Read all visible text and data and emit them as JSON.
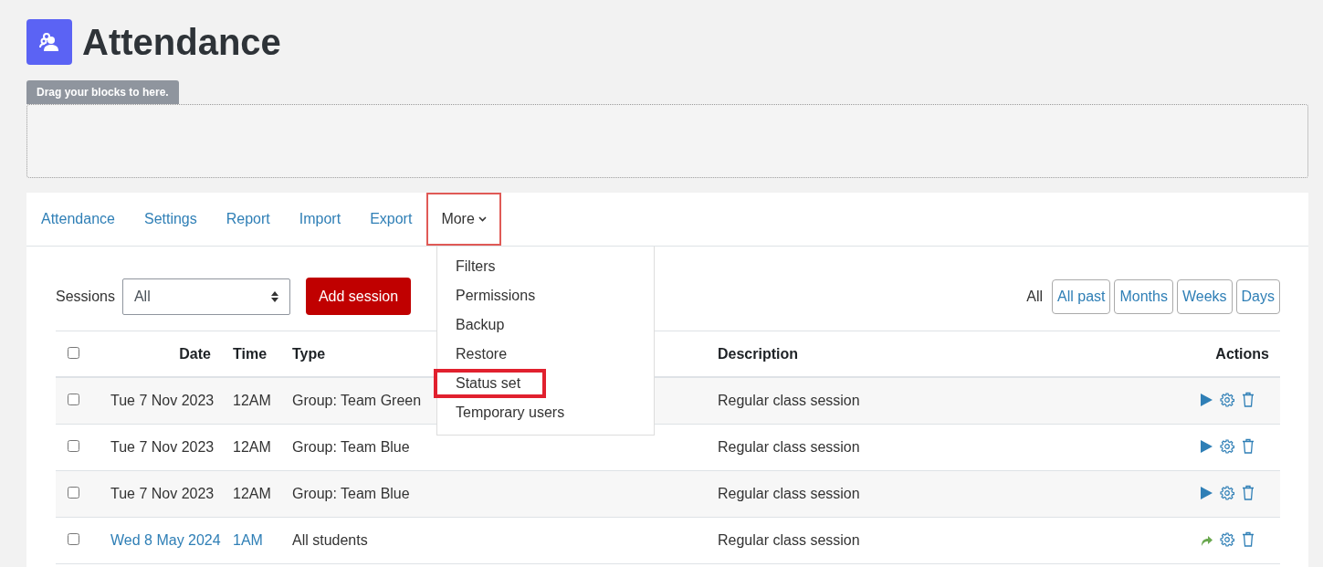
{
  "page": {
    "title": "Attendance"
  },
  "block_region": {
    "label": "Drag your blocks to here."
  },
  "tabs": [
    {
      "label": "Attendance",
      "selected": false,
      "highlighted": false
    },
    {
      "label": "Settings",
      "selected": false,
      "highlighted": false
    },
    {
      "label": "Report",
      "selected": false,
      "highlighted": false
    },
    {
      "label": "Import",
      "selected": false,
      "highlighted": false
    },
    {
      "label": "Export",
      "selected": false,
      "highlighted": false
    },
    {
      "label": "More",
      "selected": true,
      "highlighted": true
    }
  ],
  "more_menu": [
    {
      "label": "Filters",
      "highlighted": false
    },
    {
      "label": "Permissions",
      "highlighted": false
    },
    {
      "label": "Backup",
      "highlighted": false
    },
    {
      "label": "Restore",
      "highlighted": false
    },
    {
      "label": "Status set",
      "highlighted": true
    },
    {
      "label": "Temporary users",
      "highlighted": false
    }
  ],
  "sessions_filter": {
    "label": "Sessions",
    "value": "All"
  },
  "add_button": "Add session",
  "period_label": "All",
  "periods": [
    "All past",
    "Months",
    "Weeks",
    "Days"
  ],
  "table": {
    "select_all_checked": false,
    "columns": [
      "Date",
      "Time",
      "Type",
      "Description",
      "Actions"
    ],
    "rows": [
      {
        "checked": false,
        "linked": false,
        "date": "Tue 7 Nov 2023",
        "time": "12AM",
        "type": "Group: Team Green",
        "description": "Regular class session",
        "actions": [
          {
            "kind": "play"
          },
          {
            "kind": "settings"
          },
          {
            "kind": "delete"
          }
        ]
      },
      {
        "checked": false,
        "linked": false,
        "date": "Tue 7 Nov 2023",
        "time": "12AM",
        "type": "Group: Team Blue",
        "description": "Regular class session",
        "actions": [
          {
            "kind": "play"
          },
          {
            "kind": "settings"
          },
          {
            "kind": "delete"
          }
        ]
      },
      {
        "checked": false,
        "linked": false,
        "date": "Tue 7 Nov 2023",
        "time": "12AM",
        "type": "Group: Team Blue",
        "description": "Regular class session",
        "actions": [
          {
            "kind": "play"
          },
          {
            "kind": "settings"
          },
          {
            "kind": "delete"
          }
        ]
      },
      {
        "checked": false,
        "linked": true,
        "date": "Wed 8 May 2024",
        "time": "1AM",
        "type": "All students",
        "description": "Regular class session",
        "actions": [
          {
            "kind": "redo"
          },
          {
            "kind": "settings"
          },
          {
            "kind": "delete"
          }
        ]
      }
    ]
  }
}
